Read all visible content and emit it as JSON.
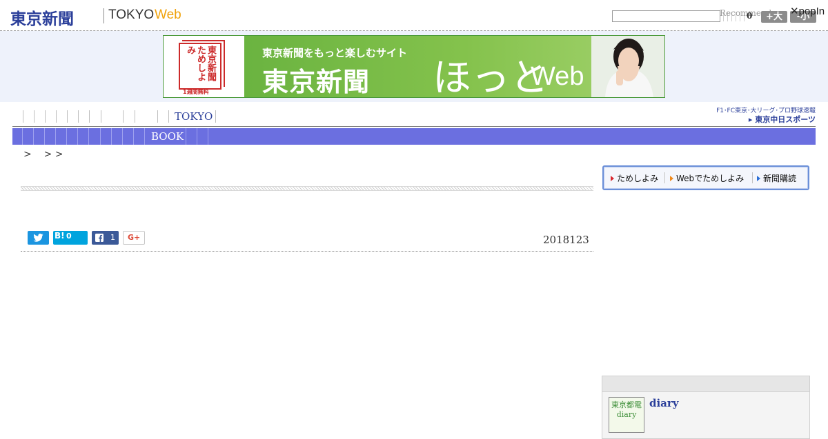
{
  "header": {
    "logo_jp": "東京新聞",
    "logo_tokyo": "TOKYO",
    "logo_web": "Web",
    "recommend_label": "Recommend",
    "search_count": "0",
    "size_up_label": "+大",
    "size_down_label": "-小",
    "popin_label": "✕popIn"
  },
  "banner": {
    "book_text": "東京新聞ためしよみ",
    "book_free": "1週間無料",
    "subtitle": "東京新聞をもっと楽しむサイト",
    "main": "東京新聞",
    "hot": "ほっと",
    "web": "Web"
  },
  "nav": {
    "tokyo_label": "TOKYO",
    "sports_top": "F1･FC東京･大リーグ･プロ野球速報",
    "sports_bottom": "▸ 東京中日スポーツ"
  },
  "catbar": {
    "book_label": "BOOK"
  },
  "breadcrumb": ">    > >",
  "article": {
    "date": "2018123",
    "share": {
      "twitter_icon": "twitter-icon",
      "hatena_label": "B!",
      "hatena_count": "0",
      "facebook_count": "1",
      "gplus_label": "G+"
    }
  },
  "sidebar": {
    "nav_items": [
      {
        "label": "ためしよみ",
        "arrow_color": "#d9282f"
      },
      {
        "label": "Webでためしよみ",
        "arrow_color": "#ef8a1e"
      },
      {
        "label": "新聞購読",
        "arrow_color": "#2b6fd6"
      }
    ],
    "diary": {
      "thumb_text": "東京都電diary",
      "title": "diary"
    }
  }
}
